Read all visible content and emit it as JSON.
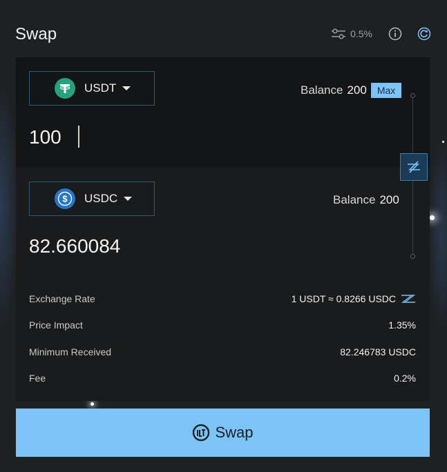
{
  "header": {
    "title": "Swap",
    "slippage": "0.5%",
    "icons": [
      "sliders-icon",
      "info-icon",
      "refresh-icon"
    ]
  },
  "from": {
    "token": "USDT",
    "balance_label": "Balance",
    "balance_value": "200",
    "max_label": "Max",
    "amount": "100",
    "logo_color": "#26a17b"
  },
  "to": {
    "token": "USDC",
    "balance_label": "Balance",
    "balance_value": "200",
    "amount": "82.660084",
    "logo_color": "#2775ca"
  },
  "details": {
    "exchange_rate_label": "Exchange Rate",
    "exchange_rate_value": "1 USDT ≈ 0.8266 USDC",
    "price_impact_label": "Price Impact",
    "price_impact_value": "1.35%",
    "min_received_label": "Minimum Received",
    "min_received_value": "82.246783 USDC",
    "fee_label": "Fee",
    "fee_value": "0.2%"
  },
  "action": {
    "swap_label": "Swap"
  },
  "colors": {
    "accent": "#7cc4f8",
    "background": "#1e2124",
    "panel_dark": "#141516",
    "panel": "#1a1b1c"
  }
}
